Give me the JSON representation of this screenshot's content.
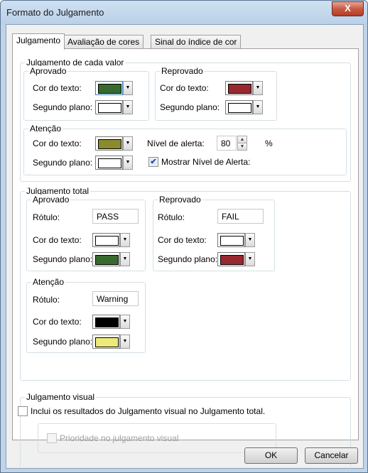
{
  "window": {
    "title": "Formato do Julgamento",
    "close_label": "X"
  },
  "tabs": [
    "Julgamento",
    "Avaliação de cores",
    "Sinal do índice de cor"
  ],
  "colors": {
    "green": "#386a30",
    "red": "#982830",
    "olive": "#8a8a30",
    "white": "#ffffff",
    "black": "#000000",
    "yellow": "#ecea7a"
  },
  "each_value": {
    "title": "Julgamento de cada valor",
    "pass": {
      "title": "Aprovado",
      "text_color_label": "Cor do texto:",
      "background_label": "Segundo plano:"
    },
    "fail": {
      "title": "Reprovado",
      "text_color_label": "Cor do texto:",
      "background_label": "Segundo plano:"
    },
    "warning": {
      "title": "Atenção",
      "text_color_label": "Cor do texto:",
      "background_label": "Segundo plano:",
      "alert_level_label": "Nível de alerta:",
      "alert_level_value": "80",
      "unit": "%",
      "show_alert_label": "Mostrar Nível de Alerta:",
      "show_alert_checked": true
    }
  },
  "total": {
    "title": "Julgamento total",
    "pass": {
      "title": "Aprovado",
      "label_label": "Rótulo:",
      "label_value": "PASS",
      "text_color_label": "Cor do texto:",
      "background_label": "Segundo plano:"
    },
    "fail": {
      "title": "Reprovado",
      "label_label": "Rótulo:",
      "label_value": "FAIL",
      "text_color_label": "Cor do texto:",
      "background_label": "Segundo plano:"
    },
    "warning": {
      "title": "Atenção",
      "label_label": "Rótulo:",
      "label_value": "Warning",
      "text_color_label": "Cor do texto:",
      "background_label": "Segundo plano:"
    }
  },
  "visual": {
    "title": "Julgamento visual",
    "include_label": "Inclui os resultados do Julgamento visual no Julgamento total.",
    "priority_label": "Prioridade no julgamento visual"
  },
  "buttons": {
    "ok": "OK",
    "cancel": "Cancelar"
  }
}
